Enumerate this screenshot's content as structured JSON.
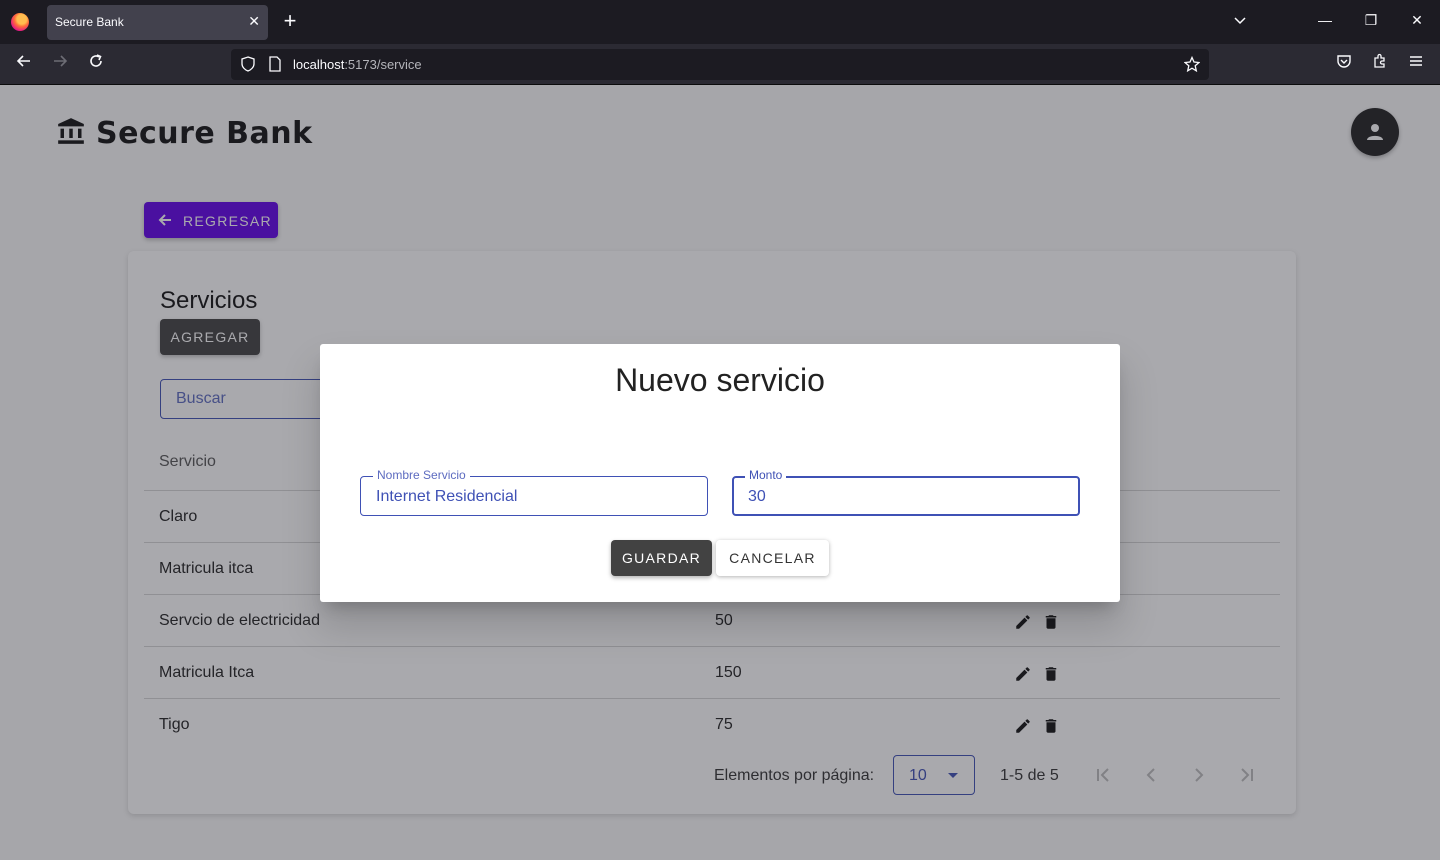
{
  "browser": {
    "tab_title": "Secure Bank",
    "url_host": "localhost",
    "url_path": ":5173/service"
  },
  "header": {
    "brand": "Secure Bank"
  },
  "back_button": "REGRESAR",
  "services": {
    "title": "Servicios",
    "add_label": "AGREGAR",
    "search_placeholder": "Buscar",
    "column_header": "Servicio",
    "rows": [
      {
        "name": "Claro",
        "amount": ""
      },
      {
        "name": "Matricula itca",
        "amount": ""
      },
      {
        "name": "Servcio de electricidad",
        "amount": "50"
      },
      {
        "name": "Matricula Itca",
        "amount": "150"
      },
      {
        "name": "Tigo",
        "amount": "75"
      }
    ],
    "pagination": {
      "label": "Elementos por página:",
      "page_size": "10",
      "range": "1-5 de 5"
    }
  },
  "dialog": {
    "title": "Nuevo servicio",
    "name_label": "Nombre Servicio",
    "name_value": "Internet Residencial",
    "amount_label": "Monto",
    "amount_value": "30",
    "save_label": "GUARDAR",
    "cancel_label": "CANCELAR"
  },
  "colors": {
    "primary": "#6200ea",
    "accent_dark": "#424242",
    "field": "#3f51b5"
  }
}
